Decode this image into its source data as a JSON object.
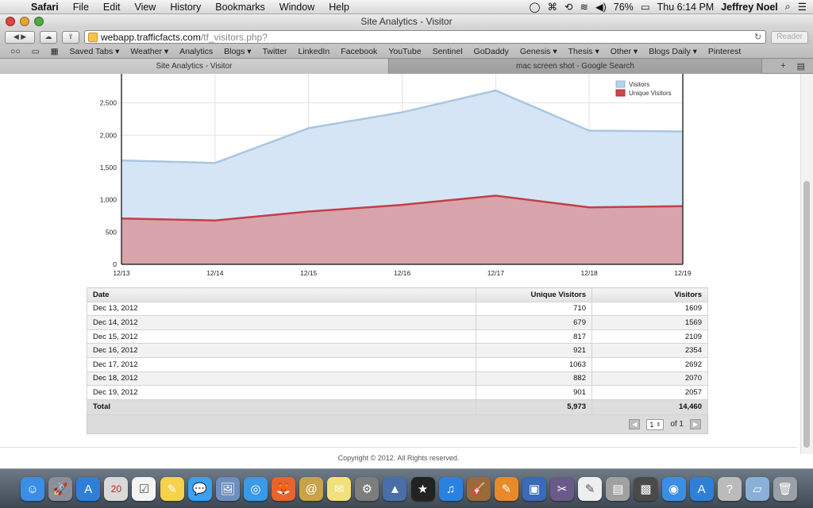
{
  "menubar": {
    "apple": "",
    "app": "Safari",
    "items": [
      "File",
      "Edit",
      "View",
      "History",
      "Bookmarks",
      "Window",
      "Help"
    ],
    "battery": "76%",
    "clock": "Thu 6:14 PM",
    "user": "Jeffrey Noel"
  },
  "window": {
    "title": "Site Analytics - Visitor"
  },
  "toolbar": {
    "url_host": "webapp.trafficfacts.com",
    "url_path": "/tf_visitors.php?",
    "reader": "Reader"
  },
  "bookmarks": [
    "Saved Tabs ▾",
    "Weather ▾",
    "Analytics",
    "Blogs ▾",
    "Twitter",
    "LinkedIn",
    "Facebook",
    "YouTube",
    "Sentinel",
    "GoDaddy",
    "Genesis ▾",
    "Thesis ▾",
    "Other ▾",
    "Blogs Daily ▾",
    "Pinterest"
  ],
  "tabs": [
    {
      "label": "Site Analytics - Visitor"
    },
    {
      "label": "mac screen shot - Google Search"
    }
  ],
  "chart_data": {
    "type": "area",
    "categories": [
      "12/13",
      "12/14",
      "12/15",
      "12/16",
      "12/17",
      "12/18",
      "12/19"
    ],
    "series": [
      {
        "name": "Visitors",
        "values": [
          1609,
          1569,
          2109,
          2354,
          2692,
          2070,
          2057
        ],
        "color": "#b8d2ea"
      },
      {
        "name": "Unique Visitors",
        "values": [
          710,
          679,
          817,
          921,
          1063,
          882,
          901
        ],
        "color": "#c9474f"
      }
    ],
    "yticks": [
      "0",
      "500",
      "1,000",
      "1,500",
      "2,000",
      "2,500"
    ],
    "ylim": [
      0,
      2950
    ],
    "grid": true,
    "legend": "top-right"
  },
  "table": {
    "headers": [
      "Date",
      "Unique Visitors",
      "Visitors"
    ],
    "rows": [
      [
        "Dec 13, 2012",
        "710",
        "1609"
      ],
      [
        "Dec 14, 2012",
        "679",
        "1569"
      ],
      [
        "Dec 15, 2012",
        "817",
        "2109"
      ],
      [
        "Dec 16, 2012",
        "921",
        "2354"
      ],
      [
        "Dec 17, 2012",
        "1063",
        "2692"
      ],
      [
        "Dec 18, 2012",
        "882",
        "2070"
      ],
      [
        "Dec 19, 2012",
        "901",
        "2057"
      ]
    ],
    "total": [
      "Total",
      "5,973",
      "14,460"
    ]
  },
  "pager": {
    "page": "1",
    "of": "of 1",
    "prev": "◀",
    "next": "▶"
  },
  "footer": "Copyright © 2012. All Rights reserved.",
  "dock": [
    "finder-icon",
    "rocket-icon",
    "appstore-icon",
    "calendar-icon",
    "reminders-icon",
    "stickies-icon",
    "messages-icon",
    "preview-icon",
    "safari-icon",
    "firefox-icon",
    "contacts-icon",
    "notes-icon",
    "preferences-icon",
    "photos-icon",
    "imovie-icon",
    "itunes-icon",
    "garageband-icon",
    "pages-icon",
    "keynote-icon",
    "capture-icon",
    "textedit-icon",
    "stamp-icon",
    "photobooth-icon",
    "wifi-icon",
    "appstore2-icon",
    "help-icon",
    "folder-icon",
    "trash-icon"
  ]
}
